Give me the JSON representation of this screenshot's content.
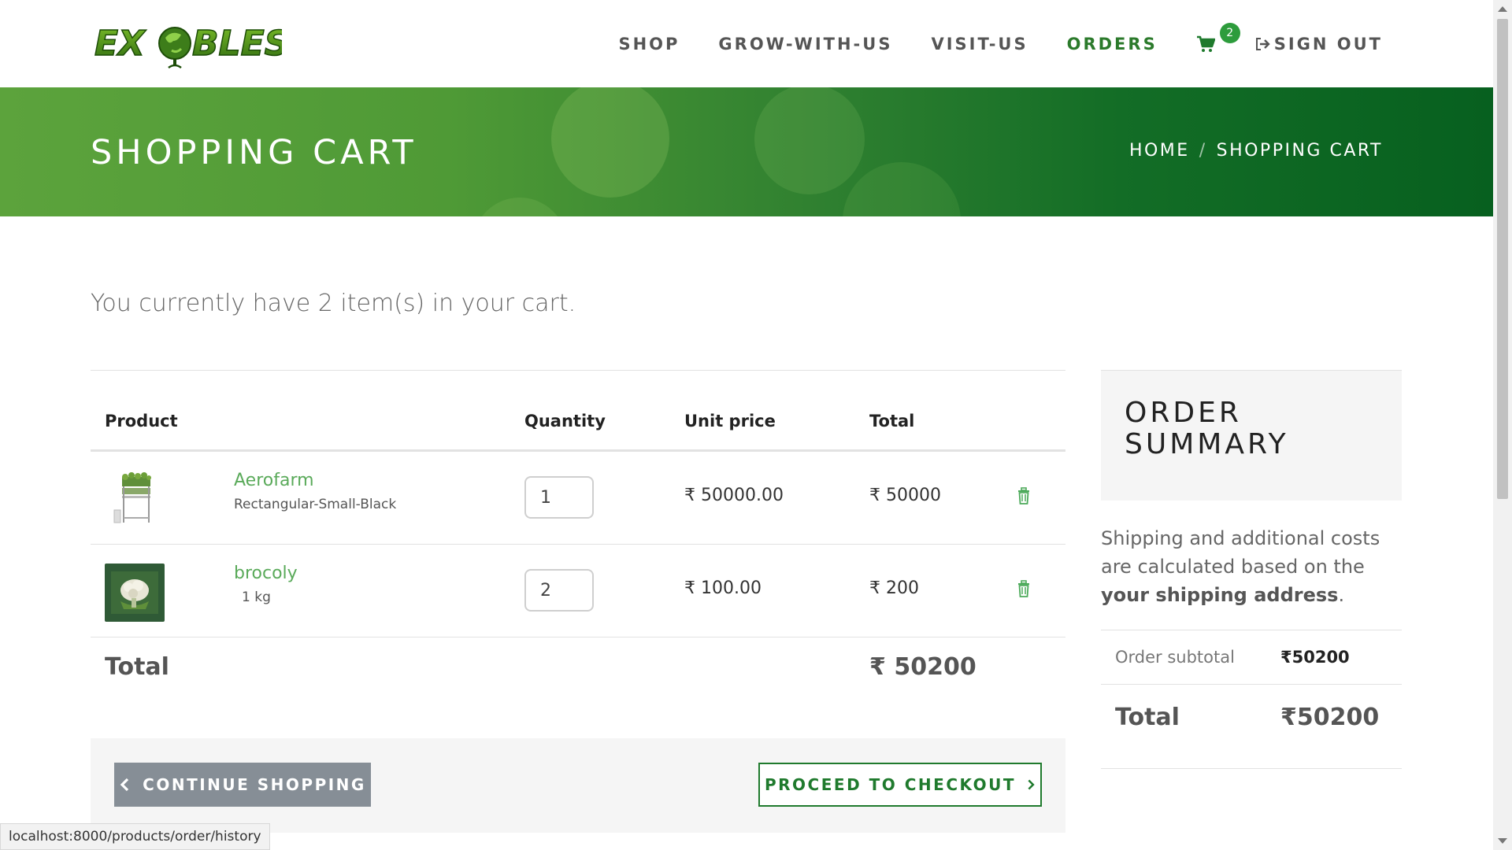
{
  "brand": {
    "logo_text": "EXOBLES"
  },
  "nav": {
    "items": [
      {
        "label": "SHOP"
      },
      {
        "label": "GROW-WITH-US"
      },
      {
        "label": "VISIT-US"
      },
      {
        "label": "ORDERS"
      }
    ],
    "cart_count": "2",
    "signout_label": "SIGN OUT",
    "active_color": "#2b7a2b"
  },
  "hero": {
    "title": "SHOPPING CART",
    "breadcrumb": {
      "home": "HOME",
      "separator": "/",
      "current": "SHOPPING CART"
    }
  },
  "cart": {
    "count_text": "You currently have 2 item(s) in your cart.",
    "columns": {
      "product": "Product",
      "quantity": "Quantity",
      "unit_price": "Unit price",
      "total": "Total"
    },
    "items": [
      {
        "name": "Aerofarm",
        "variant": "Rectangular-Small-Black",
        "quantity": "1",
        "unit_price": "₹ 50000.00",
        "total": "₹ 50000",
        "image_icon": "aerofarm-product-image"
      },
      {
        "name": "brocoly",
        "variant": "1 kg",
        "quantity": "2",
        "unit_price": "₹ 100.00",
        "total": "₹ 200",
        "image_icon": "broccoli-product-image"
      }
    ],
    "total_label": "Total",
    "total_value": "₹ 50200",
    "continue_label": "CONTINUE SHOPPING",
    "checkout_label": "PROCEED TO CHECKOUT"
  },
  "summary": {
    "title": "ORDER SUMMARY",
    "note_prefix": "Shipping and additional costs are calculated based on the ",
    "note_bold": "your shipping address",
    "note_suffix": ".",
    "subtotal_label": "Order subtotal",
    "subtotal_value": "₹50200",
    "total_label": "Total",
    "total_value": "₹50200"
  },
  "status_bar": {
    "url": "localhost:8000/products/order/history"
  },
  "colors": {
    "accent_green": "#1f7a2d",
    "link_green": "#5aaa5a",
    "badge_green": "#2d9c3c",
    "button_gray": "#868e96"
  }
}
